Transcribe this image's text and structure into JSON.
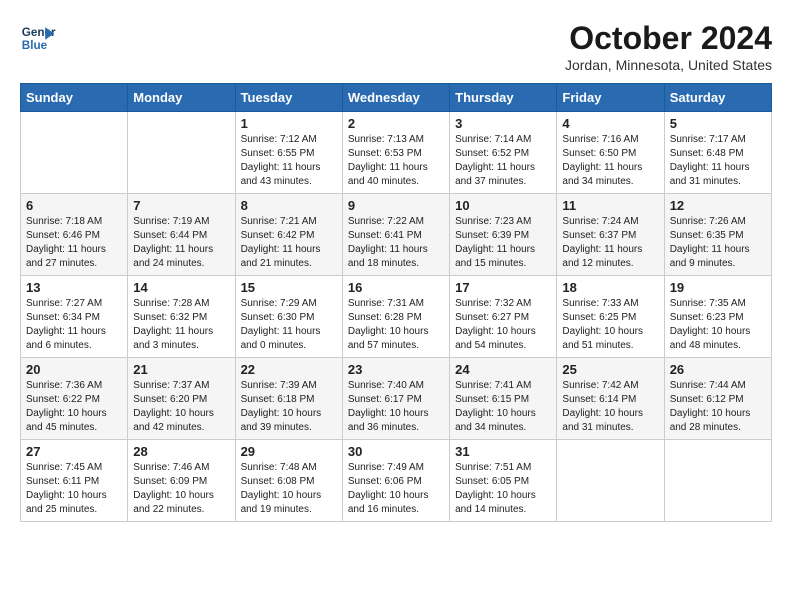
{
  "header": {
    "logo_line1": "General",
    "logo_line2": "Blue",
    "month": "October 2024",
    "location": "Jordan, Minnesota, United States"
  },
  "weekdays": [
    "Sunday",
    "Monday",
    "Tuesday",
    "Wednesday",
    "Thursday",
    "Friday",
    "Saturday"
  ],
  "weeks": [
    [
      {
        "day": "",
        "content": ""
      },
      {
        "day": "",
        "content": ""
      },
      {
        "day": "1",
        "content": "Sunrise: 7:12 AM\nSunset: 6:55 PM\nDaylight: 11 hours\nand 43 minutes."
      },
      {
        "day": "2",
        "content": "Sunrise: 7:13 AM\nSunset: 6:53 PM\nDaylight: 11 hours\nand 40 minutes."
      },
      {
        "day": "3",
        "content": "Sunrise: 7:14 AM\nSunset: 6:52 PM\nDaylight: 11 hours\nand 37 minutes."
      },
      {
        "day": "4",
        "content": "Sunrise: 7:16 AM\nSunset: 6:50 PM\nDaylight: 11 hours\nand 34 minutes."
      },
      {
        "day": "5",
        "content": "Sunrise: 7:17 AM\nSunset: 6:48 PM\nDaylight: 11 hours\nand 31 minutes."
      }
    ],
    [
      {
        "day": "6",
        "content": "Sunrise: 7:18 AM\nSunset: 6:46 PM\nDaylight: 11 hours\nand 27 minutes."
      },
      {
        "day": "7",
        "content": "Sunrise: 7:19 AM\nSunset: 6:44 PM\nDaylight: 11 hours\nand 24 minutes."
      },
      {
        "day": "8",
        "content": "Sunrise: 7:21 AM\nSunset: 6:42 PM\nDaylight: 11 hours\nand 21 minutes."
      },
      {
        "day": "9",
        "content": "Sunrise: 7:22 AM\nSunset: 6:41 PM\nDaylight: 11 hours\nand 18 minutes."
      },
      {
        "day": "10",
        "content": "Sunrise: 7:23 AM\nSunset: 6:39 PM\nDaylight: 11 hours\nand 15 minutes."
      },
      {
        "day": "11",
        "content": "Sunrise: 7:24 AM\nSunset: 6:37 PM\nDaylight: 11 hours\nand 12 minutes."
      },
      {
        "day": "12",
        "content": "Sunrise: 7:26 AM\nSunset: 6:35 PM\nDaylight: 11 hours\nand 9 minutes."
      }
    ],
    [
      {
        "day": "13",
        "content": "Sunrise: 7:27 AM\nSunset: 6:34 PM\nDaylight: 11 hours\nand 6 minutes."
      },
      {
        "day": "14",
        "content": "Sunrise: 7:28 AM\nSunset: 6:32 PM\nDaylight: 11 hours\nand 3 minutes."
      },
      {
        "day": "15",
        "content": "Sunrise: 7:29 AM\nSunset: 6:30 PM\nDaylight: 11 hours\nand 0 minutes."
      },
      {
        "day": "16",
        "content": "Sunrise: 7:31 AM\nSunset: 6:28 PM\nDaylight: 10 hours\nand 57 minutes."
      },
      {
        "day": "17",
        "content": "Sunrise: 7:32 AM\nSunset: 6:27 PM\nDaylight: 10 hours\nand 54 minutes."
      },
      {
        "day": "18",
        "content": "Sunrise: 7:33 AM\nSunset: 6:25 PM\nDaylight: 10 hours\nand 51 minutes."
      },
      {
        "day": "19",
        "content": "Sunrise: 7:35 AM\nSunset: 6:23 PM\nDaylight: 10 hours\nand 48 minutes."
      }
    ],
    [
      {
        "day": "20",
        "content": "Sunrise: 7:36 AM\nSunset: 6:22 PM\nDaylight: 10 hours\nand 45 minutes."
      },
      {
        "day": "21",
        "content": "Sunrise: 7:37 AM\nSunset: 6:20 PM\nDaylight: 10 hours\nand 42 minutes."
      },
      {
        "day": "22",
        "content": "Sunrise: 7:39 AM\nSunset: 6:18 PM\nDaylight: 10 hours\nand 39 minutes."
      },
      {
        "day": "23",
        "content": "Sunrise: 7:40 AM\nSunset: 6:17 PM\nDaylight: 10 hours\nand 36 minutes."
      },
      {
        "day": "24",
        "content": "Sunrise: 7:41 AM\nSunset: 6:15 PM\nDaylight: 10 hours\nand 34 minutes."
      },
      {
        "day": "25",
        "content": "Sunrise: 7:42 AM\nSunset: 6:14 PM\nDaylight: 10 hours\nand 31 minutes."
      },
      {
        "day": "26",
        "content": "Sunrise: 7:44 AM\nSunset: 6:12 PM\nDaylight: 10 hours\nand 28 minutes."
      }
    ],
    [
      {
        "day": "27",
        "content": "Sunrise: 7:45 AM\nSunset: 6:11 PM\nDaylight: 10 hours\nand 25 minutes."
      },
      {
        "day": "28",
        "content": "Sunrise: 7:46 AM\nSunset: 6:09 PM\nDaylight: 10 hours\nand 22 minutes."
      },
      {
        "day": "29",
        "content": "Sunrise: 7:48 AM\nSunset: 6:08 PM\nDaylight: 10 hours\nand 19 minutes."
      },
      {
        "day": "30",
        "content": "Sunrise: 7:49 AM\nSunset: 6:06 PM\nDaylight: 10 hours\nand 16 minutes."
      },
      {
        "day": "31",
        "content": "Sunrise: 7:51 AM\nSunset: 6:05 PM\nDaylight: 10 hours\nand 14 minutes."
      },
      {
        "day": "",
        "content": ""
      },
      {
        "day": "",
        "content": ""
      }
    ]
  ]
}
